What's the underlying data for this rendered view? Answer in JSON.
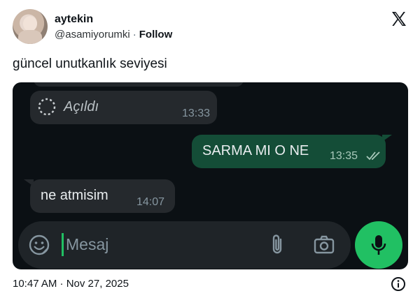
{
  "author": {
    "name": "aytekin",
    "handle": "@asamiyorumki",
    "separator": "·",
    "follow_label": "Follow"
  },
  "tweet": {
    "text": "güncel unutkanlık seviyesi",
    "timestamp": "10:47 AM · Nov 27, 2025"
  },
  "chat": {
    "messages": [
      {
        "direction": "incoming",
        "text": "Açıldı",
        "time": "13:33",
        "icon": "view-once-opened-icon"
      },
      {
        "direction": "outgoing",
        "text": "SARMA MI O NE",
        "time": "13:35",
        "status": "read-double-check"
      },
      {
        "direction": "incoming",
        "text": "ne atmisim",
        "time": "14:07"
      }
    ],
    "input_placeholder": "Mesaj",
    "icons": [
      "sticker-icon",
      "attach-icon",
      "camera-icon",
      "microphone-icon"
    ]
  },
  "colors": {
    "chat_bg": "#0b1014",
    "incoming_bubble": "#25292d",
    "outgoing_bubble": "#144d37",
    "accent_green": "#21c063"
  }
}
